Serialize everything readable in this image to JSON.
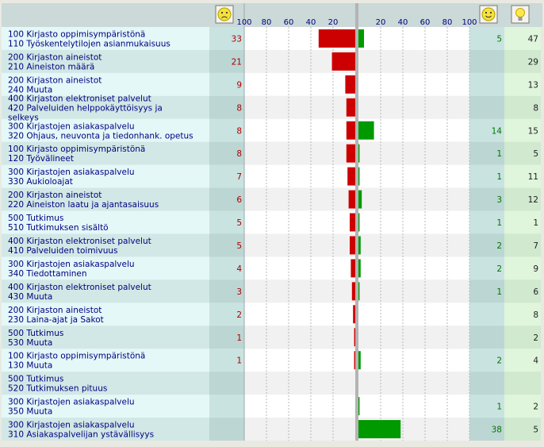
{
  "chart_data": {
    "type": "bar",
    "title": "",
    "xlabel": "",
    "ylabel": "",
    "negative_axis_ticks": [
      "100",
      "80",
      "60",
      "40",
      "20"
    ],
    "positive_axis_ticks": [
      "20",
      "40",
      "60",
      "80",
      "100"
    ],
    "xlim": [
      -100,
      100
    ],
    "rows": [
      {
        "cat_code": "100",
        "cat_name": "Kirjasto oppimisympäristönä",
        "sub_code": "110",
        "sub_name": "Työskentelytilojen asianmukaisuus",
        "neg": 33,
        "pos": 5,
        "total": 47
      },
      {
        "cat_code": "200",
        "cat_name": "Kirjaston aineistot",
        "sub_code": "210",
        "sub_name": "Aineiston määrä",
        "neg": 21,
        "pos": null,
        "total": 29
      },
      {
        "cat_code": "200",
        "cat_name": "Kirjaston aineistot",
        "sub_code": "240",
        "sub_name": "Muuta",
        "neg": 9,
        "pos": null,
        "total": 13
      },
      {
        "cat_code": "400",
        "cat_name": "Kirjaston elektroniset palvelut",
        "sub_code": "420",
        "sub_name": "Palveluiden helppokäyttöisyys ja selkeys",
        "neg": 8,
        "pos": null,
        "total": 8
      },
      {
        "cat_code": "300",
        "cat_name": "Kirjastojen asiakaspalvelu",
        "sub_code": "320",
        "sub_name": "Ohjaus, neuvonta ja tiedonhank. opetus",
        "neg": 8,
        "pos": 14,
        "total": 15
      },
      {
        "cat_code": "100",
        "cat_name": "Kirjasto oppimisympäristönä",
        "sub_code": "120",
        "sub_name": "Työvälineet",
        "neg": 8,
        "pos": 1,
        "total": 5
      },
      {
        "cat_code": "300",
        "cat_name": "Kirjastojen asiakaspalvelu",
        "sub_code": "330",
        "sub_name": "Aukioloajat",
        "neg": 7,
        "pos": 1,
        "total": 11
      },
      {
        "cat_code": "200",
        "cat_name": "Kirjaston aineistot",
        "sub_code": "220",
        "sub_name": "Aineiston laatu ja ajantasaisuus",
        "neg": 6,
        "pos": 3,
        "total": 12
      },
      {
        "cat_code": "500",
        "cat_name": "Tutkimus",
        "sub_code": "510",
        "sub_name": "Tutkimuksen sisältö",
        "neg": 5,
        "pos": 1,
        "total": 1
      },
      {
        "cat_code": "400",
        "cat_name": "Kirjaston elektroniset palvelut",
        "sub_code": "410",
        "sub_name": "Palveluiden toimivuus",
        "neg": 5,
        "pos": 2,
        "total": 7
      },
      {
        "cat_code": "300",
        "cat_name": "Kirjastojen asiakaspalvelu",
        "sub_code": "340",
        "sub_name": "Tiedottaminen",
        "neg": 4,
        "pos": 2,
        "total": 9
      },
      {
        "cat_code": "400",
        "cat_name": "Kirjaston elektroniset palvelut",
        "sub_code": "430",
        "sub_name": "Muuta",
        "neg": 3,
        "pos": 1,
        "total": 6
      },
      {
        "cat_code": "200",
        "cat_name": "Kirjaston aineistot",
        "sub_code": "230",
        "sub_name": "Laina-ajat ja Sakot",
        "neg": 2,
        "pos": null,
        "total": 8
      },
      {
        "cat_code": "500",
        "cat_name": "Tutkimus",
        "sub_code": "530",
        "sub_name": "Muuta",
        "neg": 1,
        "pos": null,
        "total": 2
      },
      {
        "cat_code": "100",
        "cat_name": "Kirjasto oppimisympäristönä",
        "sub_code": "130",
        "sub_name": "Muuta",
        "neg": 1,
        "pos": 2,
        "total": 4
      },
      {
        "cat_code": "500",
        "cat_name": "Tutkimus",
        "sub_code": "520",
        "sub_name": "Tutkimuksen pituus",
        "neg": null,
        "pos": null,
        "total": null
      },
      {
        "cat_code": "300",
        "cat_name": "Kirjastojen asiakaspalvelu",
        "sub_code": "350",
        "sub_name": "Muuta",
        "neg": null,
        "pos": 1,
        "total": 2
      },
      {
        "cat_code": "300",
        "cat_name": "Kirjastojen asiakaspalvelu",
        "sub_code": "310",
        "sub_name": "Asiakaspalvelijan ystävällisyys",
        "neg": null,
        "pos": 38,
        "total": 5
      }
    ]
  },
  "colors": {
    "negative_bar": "#cc0000",
    "positive_bar": "#009900",
    "label_text": "#000080",
    "negative_count_text": "#aa0000",
    "positive_count_text": "#007700"
  },
  "icons": {
    "negative_header": "sad-face-icon",
    "positive_header": "happy-face-icon",
    "ideas_header": "lightbulb-icon"
  }
}
